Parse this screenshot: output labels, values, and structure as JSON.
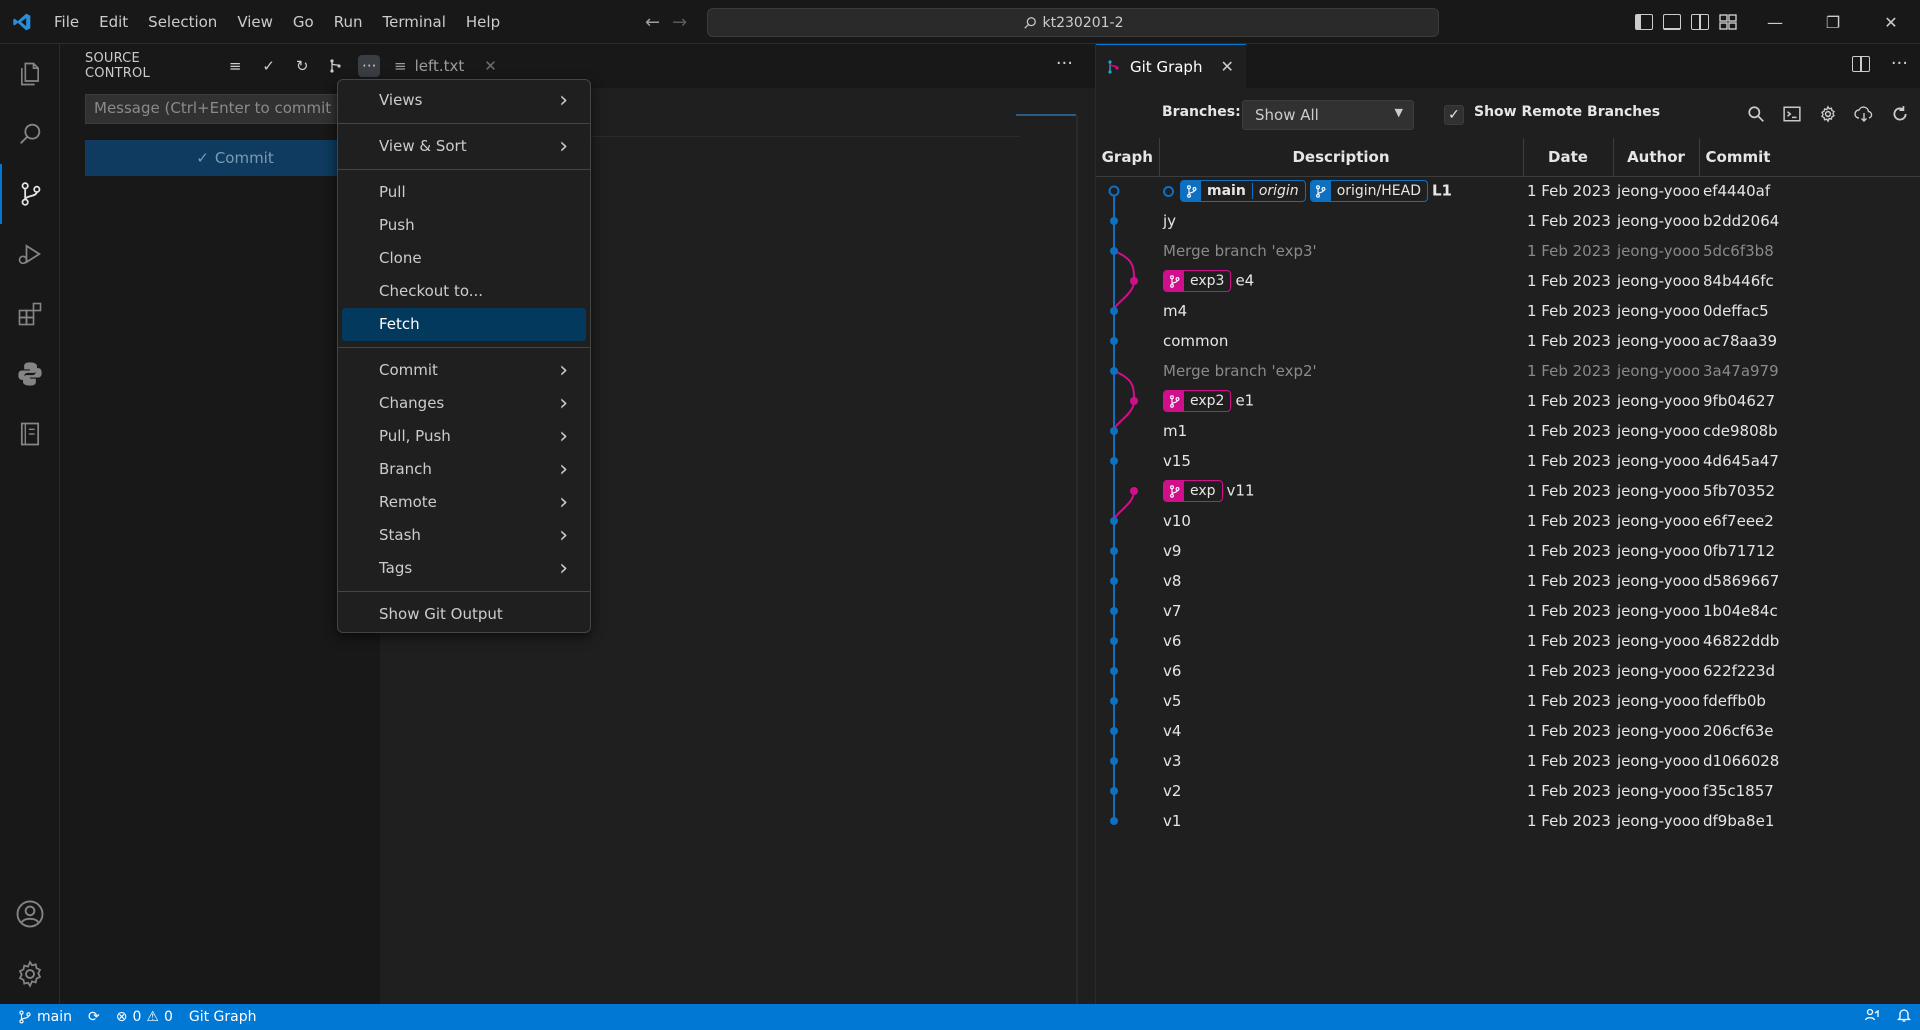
{
  "titlebar": {
    "menus": [
      "File",
      "Edit",
      "Selection",
      "View",
      "Go",
      "Run",
      "Terminal",
      "Help"
    ],
    "search_text": "kt230201-2"
  },
  "sidebar": {
    "title": "SOURCE CONTROL",
    "message_placeholder": "Message (Ctrl+Enter to commit on 'main')",
    "commit_label": "Commit"
  },
  "editor": {
    "tab_label": "left.txt"
  },
  "context_menu": {
    "items": [
      {
        "label": "Views",
        "submenu": true
      },
      {
        "label": "View & Sort",
        "submenu": true
      },
      {
        "label": "Pull",
        "submenu": false
      },
      {
        "label": "Push",
        "submenu": false
      },
      {
        "label": "Clone",
        "submenu": false
      },
      {
        "label": "Checkout to...",
        "submenu": false
      },
      {
        "label": "Fetch",
        "submenu": false,
        "selected": true
      },
      {
        "label": "Commit",
        "submenu": true
      },
      {
        "label": "Changes",
        "submenu": true
      },
      {
        "label": "Pull, Push",
        "submenu": true
      },
      {
        "label": "Branch",
        "submenu": true
      },
      {
        "label": "Remote",
        "submenu": true
      },
      {
        "label": "Stash",
        "submenu": true
      },
      {
        "label": "Tags",
        "submenu": true
      },
      {
        "label": "Show Git Output",
        "submenu": false
      }
    ]
  },
  "gitgraph": {
    "tab_label": "Git Graph",
    "branches_label": "Branches:",
    "branches_value": "Show All",
    "remote_label": "Show Remote Branches",
    "columns": [
      "Graph",
      "Description",
      "Date",
      "Author",
      "Commit"
    ],
    "colors": {
      "main": "#0e70c0",
      "branch": "#d10f8c"
    },
    "commits": [
      {
        "desc": "L1",
        "date": "1 Feb 2023 ...",
        "author": "jeong-yooon",
        "hash": "ef4440af",
        "refs": [
          {
            "name": "main",
            "remote": "origin",
            "color": "blue"
          },
          {
            "name": "origin/HEAD",
            "color": "blue"
          }
        ],
        "head": true,
        "dim": false,
        "lane": 0
      },
      {
        "desc": "jy",
        "date": "1 Feb 2023 ...",
        "author": "jeong-yooon",
        "hash": "b2dd2064",
        "refs": [],
        "dim": false,
        "lane": 0
      },
      {
        "desc": "Merge branch 'exp3'",
        "date": "1 Feb 2023 ...",
        "author": "jeong-yooon",
        "hash": "5dc6f3b8",
        "refs": [],
        "dim": true,
        "lane": 0
      },
      {
        "desc": "e4",
        "date": "1 Feb 2023 ...",
        "author": "jeong-yooon",
        "hash": "84b446fc",
        "refs": [
          {
            "name": "exp3",
            "color": "pink"
          }
        ],
        "dim": false,
        "lane": 1
      },
      {
        "desc": "m4",
        "date": "1 Feb 2023 ...",
        "author": "jeong-yooon",
        "hash": "0deffac5",
        "refs": [],
        "dim": false,
        "lane": 0
      },
      {
        "desc": "common",
        "date": "1 Feb 2023 ...",
        "author": "jeong-yooon",
        "hash": "ac78aa39",
        "refs": [],
        "dim": false,
        "lane": 0
      },
      {
        "desc": "Merge branch 'exp2'",
        "date": "1 Feb 2023 ...",
        "author": "jeong-yooon",
        "hash": "3a47a979",
        "refs": [],
        "dim": true,
        "lane": 0
      },
      {
        "desc": "e1",
        "date": "1 Feb 2023 ...",
        "author": "jeong-yooon",
        "hash": "9fb04627",
        "refs": [
          {
            "name": "exp2",
            "color": "pink"
          }
        ],
        "dim": false,
        "lane": 1
      },
      {
        "desc": "m1",
        "date": "1 Feb 2023 ...",
        "author": "jeong-yooon",
        "hash": "cde9808b",
        "refs": [],
        "dim": false,
        "lane": 0
      },
      {
        "desc": "v15",
        "date": "1 Feb 2023 ...",
        "author": "jeong-yooon",
        "hash": "4d645a47",
        "refs": [],
        "dim": false,
        "lane": 0
      },
      {
        "desc": "v11",
        "date": "1 Feb 2023 ...",
        "author": "jeong-yooon",
        "hash": "5fb70352",
        "refs": [
          {
            "name": "exp",
            "color": "pink"
          }
        ],
        "dim": false,
        "lane": 1
      },
      {
        "desc": "v10",
        "date": "1 Feb 2023 ...",
        "author": "jeong-yooon",
        "hash": "e6f7eee2",
        "refs": [],
        "dim": false,
        "lane": 0
      },
      {
        "desc": "v9",
        "date": "1 Feb 2023 ...",
        "author": "jeong-yooon",
        "hash": "0fb71712",
        "refs": [],
        "dim": false,
        "lane": 0
      },
      {
        "desc": "v8",
        "date": "1 Feb 2023 ...",
        "author": "jeong-yooon",
        "hash": "d5869667",
        "refs": [],
        "dim": false,
        "lane": 0
      },
      {
        "desc": "v7",
        "date": "1 Feb 2023 ...",
        "author": "jeong-yooon",
        "hash": "1b04e84c",
        "refs": [],
        "dim": false,
        "lane": 0
      },
      {
        "desc": "v6",
        "date": "1 Feb 2023 ...",
        "author": "jeong-yooon",
        "hash": "46822ddb",
        "refs": [],
        "dim": false,
        "lane": 0
      },
      {
        "desc": "v6",
        "date": "1 Feb 2023 ...",
        "author": "jeong-yooon",
        "hash": "622f223d",
        "refs": [],
        "dim": false,
        "lane": 0
      },
      {
        "desc": "v5",
        "date": "1 Feb 2023 ...",
        "author": "jeong-yooon",
        "hash": "fdeffb0b",
        "refs": [],
        "dim": false,
        "lane": 0
      },
      {
        "desc": "v4",
        "date": "1 Feb 2023 ...",
        "author": "jeong-yooon",
        "hash": "206cf63e",
        "refs": [],
        "dim": false,
        "lane": 0
      },
      {
        "desc": "v3",
        "date": "1 Feb 2023 ...",
        "author": "jeong-yooon",
        "hash": "d1066028",
        "refs": [],
        "dim": false,
        "lane": 0
      },
      {
        "desc": "v2",
        "date": "1 Feb 2023 ...",
        "author": "jeong-yooon",
        "hash": "f35c1857",
        "refs": [],
        "dim": false,
        "lane": 0
      },
      {
        "desc": "v1",
        "date": "1 Feb 2023 ...",
        "author": "jeong-yooon",
        "hash": "df9ba8e1",
        "refs": [],
        "dim": false,
        "lane": 0
      }
    ]
  },
  "statusbar": {
    "branch": "main",
    "errors": "0",
    "warnings": "0",
    "git_graph": "Git Graph"
  }
}
